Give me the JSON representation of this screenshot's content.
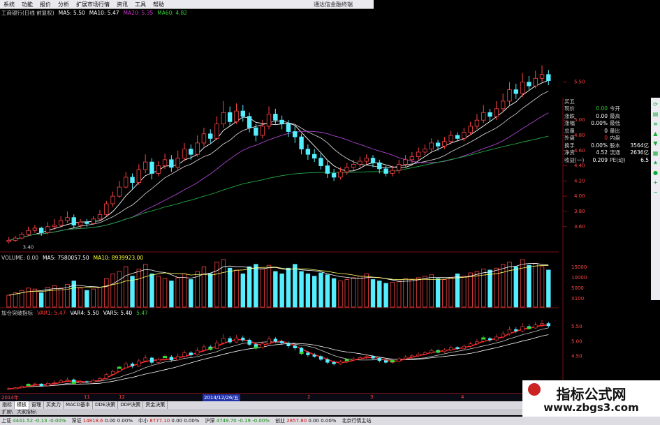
{
  "menu": {
    "items": [
      "系统",
      "功能",
      "报价",
      "分析",
      "扩展市场行情",
      "资讯",
      "工具",
      "帮助"
    ],
    "title": "通达信金融终端"
  },
  "price_panel": {
    "legend": [
      {
        "text": "工商银行(日线 前复权)",
        "color": "#cccccc"
      },
      {
        "text": "MA5: 5.50",
        "color": "#ffffff"
      },
      {
        "text": "MA10: 5.47",
        "color": "#ffffff"
      },
      {
        "text": "MA20: 5.35",
        "color": "#cc33cc"
      },
      {
        "text": "MA60: 4.82",
        "color": "#33cc33"
      }
    ],
    "low_label": "3.40"
  },
  "volume_panel": {
    "legend": [
      {
        "text": "VOLUME: 0.00",
        "color": "#cccccc"
      },
      {
        "text": "MA5: 7580057.50",
        "color": "#ffffff"
      },
      {
        "text": "MA10: 8939923.00",
        "color": "#ffff33"
      }
    ],
    "axis": [
      "15000",
      "10000",
      "5000",
      "X100"
    ]
  },
  "indicator_panel": {
    "legend": [
      {
        "text": "加仓突破指标",
        "color": "#cccccc"
      },
      {
        "text": "VAR1: 5.47",
        "color": "#ff3333"
      },
      {
        "text": "VAR4: 5.50",
        "color": "#ffffff"
      },
      {
        "text": "VAR5: 5.40",
        "color": "#ffffff"
      },
      {
        "text": "5.47",
        "color": "#33cc33"
      }
    ],
    "axis": [
      "5.50",
      "5.00",
      "4.50"
    ]
  },
  "quote_panel": {
    "rows": [
      [
        {
          "t": "买五",
          "c": "#cccccc"
        }
      ],
      [
        {
          "t": "现价",
          "c": "#cccccc"
        },
        {
          "t": "0.00",
          "c": "#33cc33"
        },
        {
          "t": "今开",
          "c": "#cccccc"
        }
      ],
      [
        {
          "t": "涨跌",
          "c": "#cccccc"
        },
        {
          "t": "0.00",
          "c": "#ffffff"
        },
        {
          "t": "最高",
          "c": "#cccccc"
        }
      ],
      [
        {
          "t": "涨幅",
          "c": "#cccccc"
        },
        {
          "t": "0.00%",
          "c": "#ffffff"
        },
        {
          "t": "最低",
          "c": "#cccccc"
        }
      ],
      [
        {
          "t": "总量",
          "c": "#cccccc"
        },
        {
          "t": "0",
          "c": "#ffffff"
        },
        {
          "t": "量比",
          "c": "#cccccc"
        }
      ],
      [
        {
          "t": "外盘",
          "c": "#cccccc"
        },
        {
          "t": "0",
          "c": "#ff3333"
        },
        {
          "t": "内盘",
          "c": "#cccccc"
        }
      ],
      [
        {
          "t": "换手",
          "c": "#cccccc"
        },
        {
          "t": "0.00%",
          "c": "#ffffff"
        },
        {
          "t": "股本",
          "c": "#cccccc"
        },
        {
          "t": "3564亿",
          "c": "#ffffff"
        }
      ],
      [
        {
          "t": "净资",
          "c": "#cccccc"
        },
        {
          "t": "4.52",
          "c": "#ffffff"
        },
        {
          "t": "流通",
          "c": "#cccccc"
        },
        {
          "t": "2636亿",
          "c": "#ffffff"
        }
      ],
      [
        {
          "t": "收益(一)",
          "c": "#cccccc"
        },
        {
          "t": "0.209",
          "c": "#ffffff"
        },
        {
          "t": "PE(动)",
          "c": "#cccccc"
        },
        {
          "t": "6.5",
          "c": "#ffffff"
        }
      ]
    ]
  },
  "date_axis": {
    "labels": [
      "2014年",
      "11",
      "12",
      "2014/12/26/五",
      "2",
      "3",
      "4"
    ],
    "highlight": "2014/12/26/五"
  },
  "tabs": [
    "指标",
    "模板",
    "窗理",
    "买卖力",
    "MACD基本",
    "DDE决策",
    "DDP决策",
    "资金决策"
  ],
  "active_tab": "模板",
  "subtabs": [
    "扩展\\",
    "大家指标\\"
  ],
  "status": [
    {
      "label": "上证",
      "value": "4441.52",
      "change": "-0.13",
      "pct": "-0.00%"
    },
    {
      "label": "深证",
      "value": "14818.6",
      "change": "0.00",
      "pct": "0.00%"
    },
    {
      "label": "中小",
      "value": "8777.10",
      "change": "0.00",
      "pct": "0.00%"
    },
    {
      "label": "沪深",
      "value": "4749.70",
      "change": "-0.19",
      "pct": "-0.00%"
    },
    {
      "label": "创业",
      "value": "2857.80",
      "change": "0.00",
      "pct": "0.00%"
    }
  ],
  "status_end": "北京行情主站",
  "watermark": {
    "title": "指标公式网",
    "url": "www.zbgs3.com"
  },
  "colors": {
    "up": "#ff4444",
    "down": "#55eeff",
    "ma20": "#aa44cc",
    "ma60": "#22aa44",
    "var1": "#ff2222"
  },
  "chart_data": {
    "type": "candlestick",
    "price_axis": [
      "5.50",
      "5.00",
      "4.80",
      "4.60",
      "4.40",
      "4.20",
      "4.00",
      "3.80",
      "3.60"
    ],
    "price_range": [
      3.35,
      5.8
    ],
    "candles": [
      [
        3.4,
        3.42,
        3.46,
        3.38
      ],
      [
        3.42,
        3.45,
        3.48,
        3.4
      ],
      [
        3.45,
        3.5,
        3.53,
        3.43
      ],
      [
        3.5,
        3.55,
        3.6,
        3.48
      ],
      [
        3.55,
        3.58,
        3.62,
        3.52
      ],
      [
        3.58,
        3.52,
        3.6,
        3.48
      ],
      [
        3.52,
        3.6,
        3.66,
        3.5
      ],
      [
        3.6,
        3.62,
        3.7,
        3.56
      ],
      [
        3.62,
        3.68,
        3.74,
        3.6
      ],
      [
        3.68,
        3.72,
        3.8,
        3.65
      ],
      [
        3.72,
        3.62,
        3.76,
        3.58
      ],
      [
        3.62,
        3.66,
        3.7,
        3.58
      ],
      [
        3.66,
        3.64,
        3.7,
        3.6
      ],
      [
        3.64,
        3.7,
        3.74,
        3.62
      ],
      [
        3.7,
        3.76,
        3.82,
        3.68
      ],
      [
        3.76,
        3.9,
        3.94,
        3.74
      ],
      [
        3.9,
        4.0,
        4.06,
        3.86
      ],
      [
        4.0,
        4.12,
        4.2,
        3.98
      ],
      [
        4.12,
        4.25,
        4.32,
        4.1
      ],
      [
        4.25,
        4.18,
        4.3,
        4.1
      ],
      [
        4.18,
        4.35,
        4.42,
        4.15
      ],
      [
        4.35,
        4.45,
        4.55,
        4.3
      ],
      [
        4.45,
        4.3,
        4.5,
        4.22
      ],
      [
        4.3,
        4.4,
        4.46,
        4.26
      ],
      [
        4.4,
        4.48,
        4.56,
        4.36
      ],
      [
        4.48,
        4.38,
        4.54,
        4.32
      ],
      [
        4.38,
        4.5,
        4.6,
        4.35
      ],
      [
        4.5,
        4.62,
        4.7,
        4.46
      ],
      [
        4.62,
        4.55,
        4.68,
        4.48
      ],
      [
        4.55,
        4.7,
        4.8,
        4.52
      ],
      [
        4.7,
        4.82,
        4.9,
        4.66
      ],
      [
        4.82,
        4.76,
        4.88,
        4.7
      ],
      [
        4.76,
        4.95,
        5.05,
        4.74
      ],
      [
        4.95,
        5.1,
        5.25,
        4.9
      ],
      [
        5.1,
        4.98,
        5.18,
        4.92
      ],
      [
        4.98,
        5.12,
        5.22,
        4.95
      ],
      [
        5.12,
        5.05,
        5.2,
        4.98
      ],
      [
        5.05,
        4.9,
        5.1,
        4.84
      ],
      [
        4.9,
        4.8,
        4.95,
        4.72
      ],
      [
        4.8,
        4.92,
        5.0,
        4.76
      ],
      [
        4.92,
        5.08,
        5.18,
        4.88
      ],
      [
        5.08,
        5.0,
        5.15,
        4.95
      ],
      [
        5.0,
        4.95,
        5.06,
        4.88
      ],
      [
        4.95,
        4.85,
        5.0,
        4.78
      ],
      [
        4.85,
        4.78,
        4.92,
        4.7
      ],
      [
        4.78,
        4.62,
        4.82,
        4.55
      ],
      [
        4.62,
        4.55,
        4.68,
        4.48
      ],
      [
        4.55,
        4.5,
        4.62,
        4.45
      ],
      [
        4.5,
        4.4,
        4.56,
        4.35
      ],
      [
        4.4,
        4.3,
        4.46,
        4.24
      ],
      [
        4.3,
        4.25,
        4.36,
        4.2
      ],
      [
        4.25,
        4.32,
        4.38,
        4.22
      ],
      [
        4.32,
        4.38,
        4.44,
        4.28
      ],
      [
        4.38,
        4.42,
        4.48,
        4.34
      ],
      [
        4.42,
        4.46,
        4.52,
        4.38
      ],
      [
        4.46,
        4.5,
        4.55,
        4.42
      ],
      [
        4.5,
        4.44,
        4.54,
        4.38
      ],
      [
        4.44,
        4.36,
        4.48,
        4.3
      ],
      [
        4.36,
        4.3,
        4.4,
        4.26
      ],
      [
        4.3,
        4.34,
        4.4,
        4.26
      ],
      [
        4.34,
        4.42,
        4.48,
        4.3
      ],
      [
        4.42,
        4.48,
        4.54,
        4.38
      ],
      [
        4.48,
        4.52,
        4.58,
        4.44
      ],
      [
        4.52,
        4.58,
        4.64,
        4.48
      ],
      [
        4.58,
        4.62,
        4.68,
        4.54
      ],
      [
        4.62,
        4.7,
        4.76,
        4.58
      ],
      [
        4.7,
        4.66,
        4.74,
        4.6
      ],
      [
        4.66,
        4.72,
        4.78,
        4.62
      ],
      [
        4.72,
        4.8,
        4.86,
        4.68
      ],
      [
        4.8,
        4.76,
        4.84,
        4.72
      ],
      [
        4.76,
        4.84,
        4.9,
        4.72
      ],
      [
        4.84,
        4.92,
        4.98,
        4.8
      ],
      [
        4.92,
        5.0,
        5.08,
        4.88
      ],
      [
        5.0,
        5.1,
        5.2,
        4.96
      ],
      [
        5.1,
        5.05,
        5.15,
        4.98
      ],
      [
        5.05,
        5.15,
        5.25,
        5.0
      ],
      [
        5.15,
        5.25,
        5.35,
        5.1
      ],
      [
        5.25,
        5.4,
        5.5,
        5.2
      ],
      [
        5.4,
        5.35,
        5.48,
        5.28
      ],
      [
        5.35,
        5.5,
        5.62,
        5.3
      ],
      [
        5.5,
        5.45,
        5.58,
        5.4
      ],
      [
        5.45,
        5.55,
        5.65,
        5.42
      ],
      [
        5.55,
        5.6,
        5.72,
        5.5
      ],
      [
        5.6,
        5.52,
        5.66,
        5.46
      ]
    ],
    "volumes": [
      25,
      30,
      35,
      40,
      38,
      30,
      42,
      45,
      40,
      48,
      55,
      40,
      35,
      38,
      42,
      60,
      70,
      75,
      85,
      65,
      80,
      90,
      70,
      65,
      60,
      55,
      62,
      70,
      58,
      75,
      85,
      70,
      95,
      100,
      82,
      78,
      70,
      85,
      90,
      80,
      88,
      75,
      70,
      82,
      90,
      75,
      70,
      65,
      72,
      68,
      60,
      55,
      58,
      62,
      65,
      70,
      58,
      55,
      50,
      52,
      55,
      60,
      58,
      62,
      65,
      68,
      60,
      58,
      62,
      70,
      65,
      72,
      75,
      80,
      78,
      82,
      90,
      95,
      85,
      100,
      88,
      92,
      85,
      78
    ],
    "price_ma": {
      "ma5": "white",
      "ma10": "#dddddd",
      "ma20": "#aa44cc",
      "ma60": "#22aa44"
    }
  }
}
